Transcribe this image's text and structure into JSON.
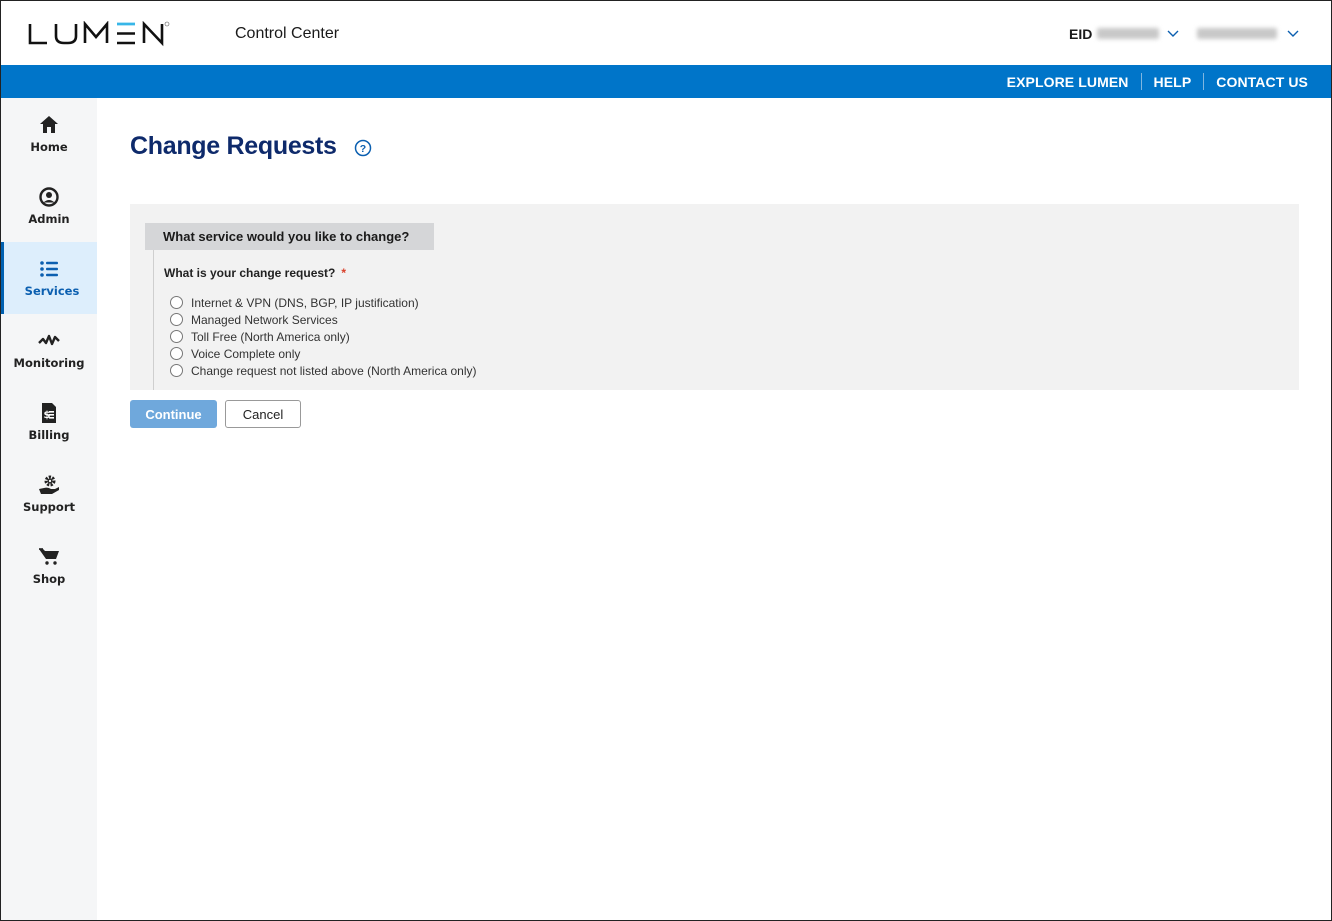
{
  "header": {
    "brand": "LUMEN",
    "app_title": "Control Center",
    "eid_label": "EID",
    "eid_value_redacted": true,
    "user_redacted": true
  },
  "topnav": {
    "links": [
      "EXPLORE LUMEN",
      "HELP",
      "CONTACT US"
    ]
  },
  "sidebar": {
    "items": [
      {
        "label": "Home",
        "icon": "home-icon",
        "active": false
      },
      {
        "label": "Admin",
        "icon": "user-circle-icon",
        "active": false
      },
      {
        "label": "Services",
        "icon": "list-icon",
        "active": true
      },
      {
        "label": "Monitoring",
        "icon": "pulse-icon",
        "active": false
      },
      {
        "label": "Billing",
        "icon": "invoice-icon",
        "active": false
      },
      {
        "label": "Support",
        "icon": "support-gear-hand-icon",
        "active": false
      },
      {
        "label": "Shop",
        "icon": "cart-icon",
        "active": false
      }
    ]
  },
  "main": {
    "title": "Change Requests",
    "section_heading": "What service would you like to change?",
    "question": "What is your change request?",
    "required_marker": "*",
    "options": [
      "Internet & VPN (DNS, BGP, IP justification)",
      "Managed Network Services",
      "Toll Free (North America only)",
      "Voice Complete only",
      "Change request not listed above (North America only)"
    ],
    "continue_label": "Continue",
    "cancel_label": "Cancel"
  },
  "colors": {
    "brand_blue": "#0075c9",
    "title_navy": "#0e2a6b",
    "continue_disabled": "#6fa8dc",
    "logo_accent": "#38b6e8"
  }
}
